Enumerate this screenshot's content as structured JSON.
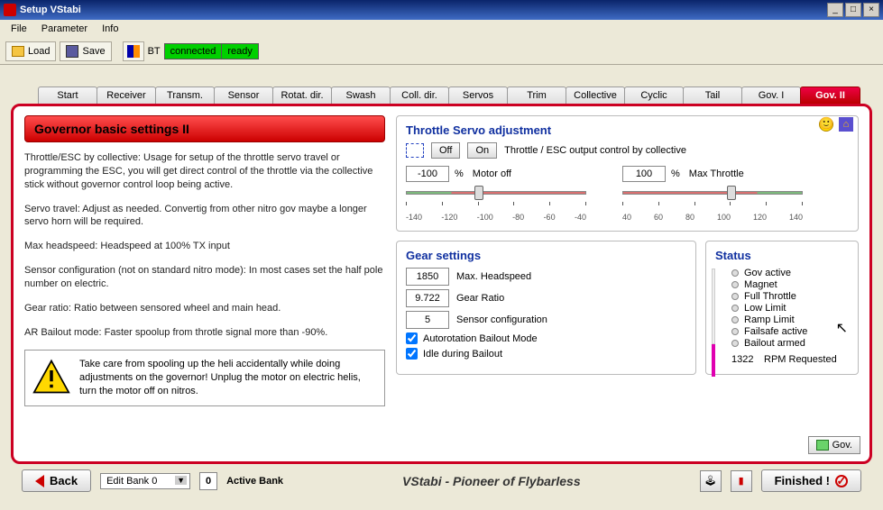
{
  "window": {
    "title": "Setup VStabi"
  },
  "menus": {
    "file": "File",
    "parameter": "Parameter",
    "info": "Info"
  },
  "toolbar": {
    "load": "Load",
    "save": "Save",
    "bt_label": "BT",
    "bt_conn": "connected",
    "bt_ready": "ready"
  },
  "tabs": [
    "Start",
    "Receiver",
    "Transm.",
    "Sensor",
    "Rotat. dir.",
    "Swash",
    "Coll. dir.",
    "Servos",
    "Trim",
    "Collective",
    "Cyclic",
    "Tail",
    "Gov. I",
    "Gov. II"
  ],
  "active_tab": "Gov. II",
  "section_title": "Governor basic settings II",
  "desc": {
    "p1": "Throttle/ESC by collective: Usage for setup of the throttle servo travel or programming the ESC, you will get direct control of the throttle via the collective stick without governor control loop being active.",
    "p2": "Servo travel: Adjust as needed. Convertig from other nitro gov maybe a longer servo horn will be required.",
    "p3": "Max headspeed: Headspeed at 100% TX input",
    "p4": "Sensor configuration (not on standard nitro mode): In most cases set the half pole number on electric.",
    "p5": "Gear ratio: Ratio between sensored wheel and main head.",
    "p6": "AR Bailout mode: Faster spoolup from throtle signal more than -90%."
  },
  "warning": "Take care from spooling up the heli accidentally while doing adjustments on the governor! Unplug the motor on electric helis, turn the motor off on nitros.",
  "throttle": {
    "title": "Throttle Servo adjustment",
    "off": "Off",
    "on": "On",
    "by_collective": "Throttle / ESC output control by collective",
    "motor_off_val": "-100",
    "motor_off_unit": "%",
    "motor_off_label": "Motor off",
    "max_val": "100",
    "max_unit": "%",
    "max_label": "Max Throttle",
    "ticks_left": [
      "-140",
      "-120",
      "-100",
      "-80",
      "-60",
      "-40"
    ],
    "ticks_right": [
      "40",
      "60",
      "80",
      "100",
      "120",
      "140"
    ]
  },
  "gear": {
    "title": "Gear settings",
    "max_headspeed": "1850",
    "max_headspeed_label": "Max. Headspeed",
    "gear_ratio": "9.722",
    "gear_ratio_label": "Gear Ratio",
    "sensor_cfg": "5",
    "sensor_cfg_label": "Sensor configuration",
    "ar_bailout": "Autorotation Bailout Mode",
    "idle_bailout": "Idle during Bailout"
  },
  "status": {
    "title": "Status",
    "items": [
      "Gov active",
      "Magnet",
      "Full Throttle",
      "Low Limit",
      "Ramp Limit",
      "Failsafe active",
      "Bailout armed"
    ],
    "rpm_val": "1322",
    "rpm_label": "RPM Requested",
    "gov_btn": "Gov."
  },
  "bottom": {
    "back": "Back",
    "bank_edit": "Edit Bank 0",
    "bank_active_num": "0",
    "bank_active_label": "Active Bank",
    "slogan": "VStabi - Pioneer of Flybarless",
    "finished": "Finished !"
  }
}
